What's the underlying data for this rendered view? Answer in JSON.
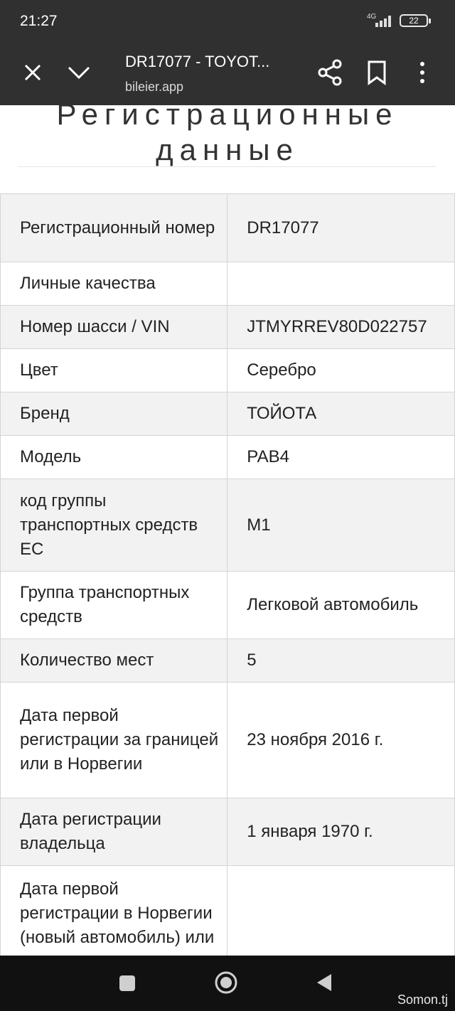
{
  "status_bar": {
    "time": "21:27",
    "network": "4G",
    "battery": "22"
  },
  "toolbar": {
    "title": "DR17077 - TOYOT...",
    "url": "bileier.app",
    "icons": [
      "close-icon",
      "chevron-down-icon",
      "share-icon",
      "bookmark-icon",
      "more-vert-icon"
    ]
  },
  "page": {
    "heading_line1": "Регистрационные",
    "heading_line2": "данные",
    "rows": [
      {
        "label": "Регистрационный номер",
        "value": "DR17077"
      },
      {
        "label": "Личные качества",
        "value": ""
      },
      {
        "label": "Номер шасси / VIN",
        "value": "JTMYRREV80D022757"
      },
      {
        "label": "Цвет",
        "value": "Серебро"
      },
      {
        "label": "Бренд",
        "value": "ТОЙОТА"
      },
      {
        "label": "Модель",
        "value": "РАВ4"
      },
      {
        "label": "код группы транспортных средств ЕС",
        "value": "M1"
      },
      {
        "label": "Группа транспортных средств",
        "value": "Легковой автомобиль"
      },
      {
        "label": "Количество мест",
        "value": "5"
      },
      {
        "label": "Дата первой регистрации за границей или в Норвегии",
        "value": "23 ноября 2016 г."
      },
      {
        "label": "Дата регистрации владельца",
        "value": "1 января 1970 г."
      },
      {
        "label": "Дата первой регистрации в Норвегии (новый автомобиль) или со",
        "value": ""
      }
    ]
  },
  "nav_bar": {
    "icons": [
      "recents-square-icon",
      "home-circle-icon",
      "back-triangle-icon"
    ]
  },
  "watermark": "Somon.tj"
}
